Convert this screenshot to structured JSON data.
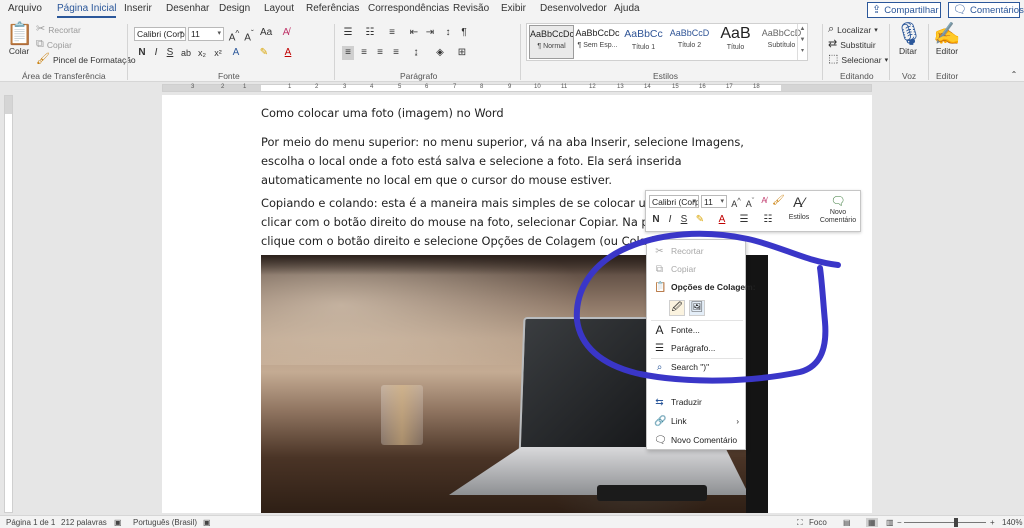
{
  "tabs": [
    "Arquivo",
    "Página Inicial",
    "Inserir",
    "Desenhar",
    "Design",
    "Layout",
    "Referências",
    "Correspondências",
    "Revisão",
    "Exibir",
    "Desenvolvedor",
    "Ajuda"
  ],
  "share_label": "Compartilhar",
  "comments_label": "Comentários",
  "clipboard": {
    "paste_label": "Colar",
    "cut_label": "Recortar",
    "copy_label": "Copiar",
    "format_painter_label": "Pincel de Formatação",
    "group_label": "Área de Transferência"
  },
  "font": {
    "name": "Calibri (Corp",
    "size": "11",
    "group_label": "Fonte",
    "bold": "N",
    "italic": "I",
    "underline": "S"
  },
  "paragraph": {
    "group_label": "Parágrafo"
  },
  "styles": {
    "group_label": "Estilos",
    "items": [
      {
        "preview": "AaBbCcDc",
        "name": "¶ Normal"
      },
      {
        "preview": "AaBbCcDc",
        "name": "¶ Sem Esp..."
      },
      {
        "preview": "AaBbCc",
        "name": "Título 1"
      },
      {
        "preview": "AaBbCcD",
        "name": "Título 2"
      },
      {
        "preview": "AaB",
        "name": "Título"
      },
      {
        "preview": "AaBbCcD",
        "name": "Subtítulo"
      }
    ]
  },
  "editing": {
    "group_label": "Editando",
    "find_label": "Localizar",
    "replace_label": "Substituir",
    "select_label": "Selecionar"
  },
  "voice": {
    "dictate_label": "Ditar",
    "group_label": "Voz"
  },
  "editor": {
    "button_label": "Editor",
    "group_label": "Editor"
  },
  "ruler_numbers": [
    "3",
    "2",
    "1",
    "1",
    "2",
    "3",
    "4",
    "5",
    "6",
    "7",
    "8",
    "9",
    "10",
    "11",
    "12",
    "13",
    "14",
    "15",
    "16",
    "17",
    "18"
  ],
  "document": {
    "title": "Como colocar uma foto (imagem) no Word",
    "para1": "Por meio do menu superior: no menu superior, vá na aba Inserir, selecione Imagens, escolha o local onde a foto está salva e selecione a foto. Ela será inserida automaticamente no local em que o cursor do mouse estiver.",
    "para2_line1": "Copiando e colando: esta é a maneira mais simples de se colocar uma fo",
    "para2_line2": "clicar com o botão direito do mouse na foto, selecionar Copiar. Na págin",
    "para2_line3": "clique com o botão direito e selecione Opções de Colagem (ou Colar)."
  },
  "mini_toolbar": {
    "font": "Calibri (Corp",
    "size": "11",
    "styles_label": "Estilos",
    "new_comment_label": "Novo Comentário"
  },
  "context_menu": {
    "cut": "Recortar",
    "copy": "Copiar",
    "paste_options": "Opções de Colagem:",
    "font": "Fonte...",
    "paragraph": "Parágrafo...",
    "search": "Search \")\"",
    "translate": "Traduzir",
    "link": "Link",
    "new_comment": "Novo Comentário"
  },
  "annotation_color": "#3a36c8",
  "status": {
    "page": "Página 1 de 1",
    "words": "212 palavras",
    "language": "Português (Brasil)",
    "focus": "Foco",
    "zoom": "140%"
  }
}
